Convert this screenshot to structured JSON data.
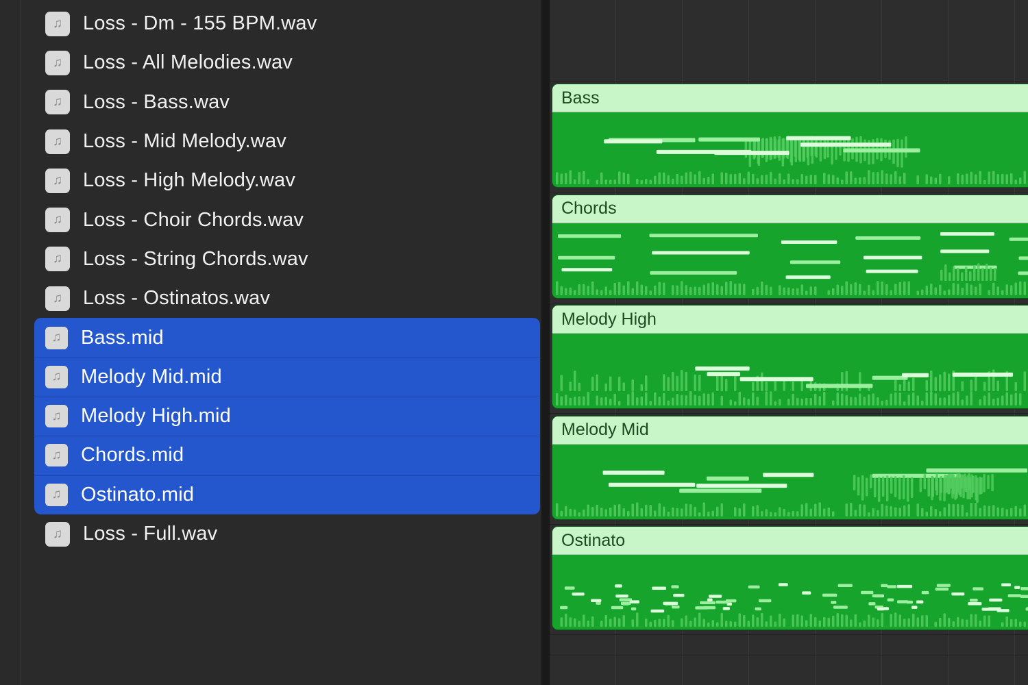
{
  "app": {
    "name": "DAW arrange view with media file list"
  },
  "colors": {
    "background": "#2a2a2a",
    "selection_blue": "#2456cd",
    "row_text": "#f1f1f1",
    "icon_bg": "#d9d9d9",
    "icon_glyph_color": "#8e8e8e",
    "arrange_bg": "#2d2d2d",
    "grid_line": "#3a3a3a",
    "region_body": "#17a42c",
    "region_header_bg": "#c9f6c9",
    "region_header_text": "#1d4a20",
    "note_bar": "#9bef9e",
    "note_bar_bright": "#dcfcdc",
    "note_tick": "#54cd5f"
  },
  "file_list": {
    "icon_glyph": "♫",
    "items": [
      {
        "label": "Loss - Dm - 155 BPM.wav",
        "selected": false
      },
      {
        "label": "Loss - All Melodies.wav",
        "selected": false
      },
      {
        "label": "Loss - Bass.wav",
        "selected": false
      },
      {
        "label": "Loss - Mid Melody.wav",
        "selected": false
      },
      {
        "label": "Loss - High Melody.wav",
        "selected": false
      },
      {
        "label": "Loss - Choir Chords.wav",
        "selected": false
      },
      {
        "label": "Loss - String Chords.wav",
        "selected": false
      },
      {
        "label": "Loss - Ostinatos.wav",
        "selected": false
      },
      {
        "label": "Bass.mid",
        "selected": true
      },
      {
        "label": "Melody Mid.mid",
        "selected": true
      },
      {
        "label": "Melody High.mid",
        "selected": true
      },
      {
        "label": "Chords.mid",
        "selected": true
      },
      {
        "label": "Ostinato.mid",
        "selected": true
      },
      {
        "label": "Loss - Full.wav",
        "selected": false
      }
    ]
  },
  "arrange": {
    "regions": [
      {
        "name": "Bass",
        "pattern": "bass",
        "seed": 101
      },
      {
        "name": "Chords",
        "pattern": "chords",
        "seed": 202
      },
      {
        "name": "Melody High",
        "pattern": "melody-high",
        "seed": 303
      },
      {
        "name": "Melody Mid",
        "pattern": "melody-mid",
        "seed": 404
      },
      {
        "name": "Ostinato",
        "pattern": "ostinato",
        "seed": 505
      }
    ]
  }
}
